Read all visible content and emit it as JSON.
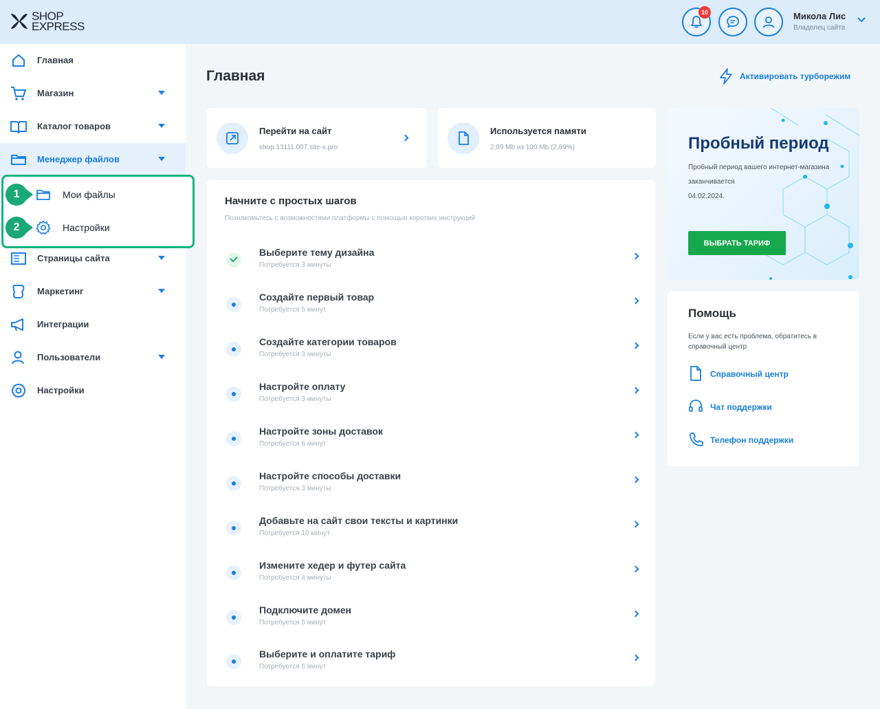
{
  "header": {
    "logo_line1": "SHOP",
    "logo_line2": "EXPRESS",
    "notification_count": "10",
    "user_name": "Микола Лис",
    "user_role": "Владелец сайта"
  },
  "sidebar": {
    "items": [
      {
        "label": "Главная"
      },
      {
        "label": "Магазин"
      },
      {
        "label": "Каталог товаров"
      },
      {
        "label": "Менеджер файлов"
      },
      {
        "label": "Страницы сайта"
      },
      {
        "label": "Маркетинг"
      },
      {
        "label": "Интеграции"
      },
      {
        "label": "Пользователи"
      },
      {
        "label": "Настройки"
      }
    ],
    "submenu": [
      {
        "number": "1",
        "label": "Мои файлы"
      },
      {
        "number": "2",
        "label": "Настройки"
      }
    ]
  },
  "main": {
    "title": "Главная",
    "turbo_label": "Активировать турборежим",
    "site_card": {
      "title": "Перейти на сайт",
      "subtitle": "shop.13111.007.site-x.pro"
    },
    "memory_card": {
      "title": "Используется памяти",
      "subtitle": "2,89 Mb из 100 Mb (2,89%)"
    },
    "steps": {
      "title": "Начните с простых шагов",
      "subtitle": "Познакомьтесь с возможностями платформы с помощью коротких инструкций",
      "items": [
        {
          "title": "Выберите тему дизайна",
          "time": "Потребуется 3 минуты"
        },
        {
          "title": "Создайте первый товар",
          "time": "Потребуется 5 минут"
        },
        {
          "title": "Создайте категории товаров",
          "time": "Потребуется 3 минуты"
        },
        {
          "title": "Настройте оплату",
          "time": "Потребуется 3 минуты"
        },
        {
          "title": "Настройте зоны доставок",
          "time": "Потребуется 6 минут"
        },
        {
          "title": "Настройте способы доставки",
          "time": "Потребуется 3 минуты"
        },
        {
          "title": "Добавьте на сайт свои тексты и картинки",
          "time": "Потребуется 10 минут"
        },
        {
          "title": "Измените хедер и футер сайта",
          "time": "Потребуется 4 минуты"
        },
        {
          "title": "Подключите домен",
          "time": "Потребуется 5 минут"
        },
        {
          "title": "Выберите и оплатите тариф",
          "time": "Потребуется 6 минут"
        }
      ]
    }
  },
  "trial": {
    "title": "Пробный период",
    "text": "Пробный период вашего интернет-магазина заканчивается",
    "date": "04.02.2024.",
    "button": "ВЫБРАТЬ ТАРИФ"
  },
  "help": {
    "title": "Помощь",
    "text": "Если у вас есть проблема, обратитесь в справочный центр",
    "links": [
      {
        "label": "Справочный центр"
      },
      {
        "label": "Чат поддержки"
      },
      {
        "label": "Телефон поддержки"
      }
    ]
  },
  "colors": {
    "accent": "#1a7fe0",
    "highlight": "#14b37d",
    "cta": "#17a84d",
    "badge": "#ef3a3a"
  },
  "icons": {
    "logo": "shop-express-logo",
    "notifications": "bell-icon",
    "messages": "chat-icon",
    "profile": "user-icon",
    "turbo": "lightning-icon"
  }
}
